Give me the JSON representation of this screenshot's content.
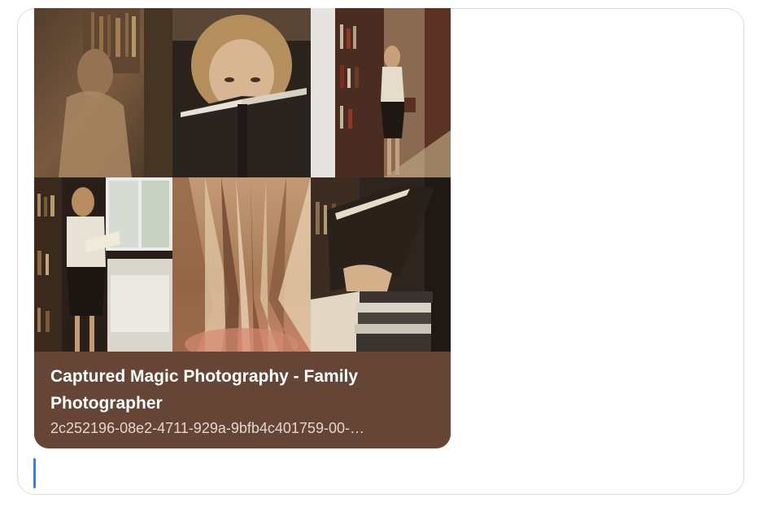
{
  "attachment": {
    "title": "Captured Magic Photography - Family Photographer",
    "subtitle": "2c252196-08e2-4711-929a-9bfb4c401759-00-…",
    "photos": [
      {
        "name": "photo-woman-reading-shelves"
      },
      {
        "name": "photo-woman-peeking-over-book"
      },
      {
        "name": "photo-woman-browsing-library"
      },
      {
        "name": "photo-woman-reading-by-window"
      },
      {
        "name": "photo-book-pages-closeup"
      },
      {
        "name": "photo-hands-holding-book-stack"
      }
    ]
  },
  "colors": {
    "caption_background": "#654536",
    "cursor": "#2f7cf6",
    "border": "#dcdcdc"
  }
}
